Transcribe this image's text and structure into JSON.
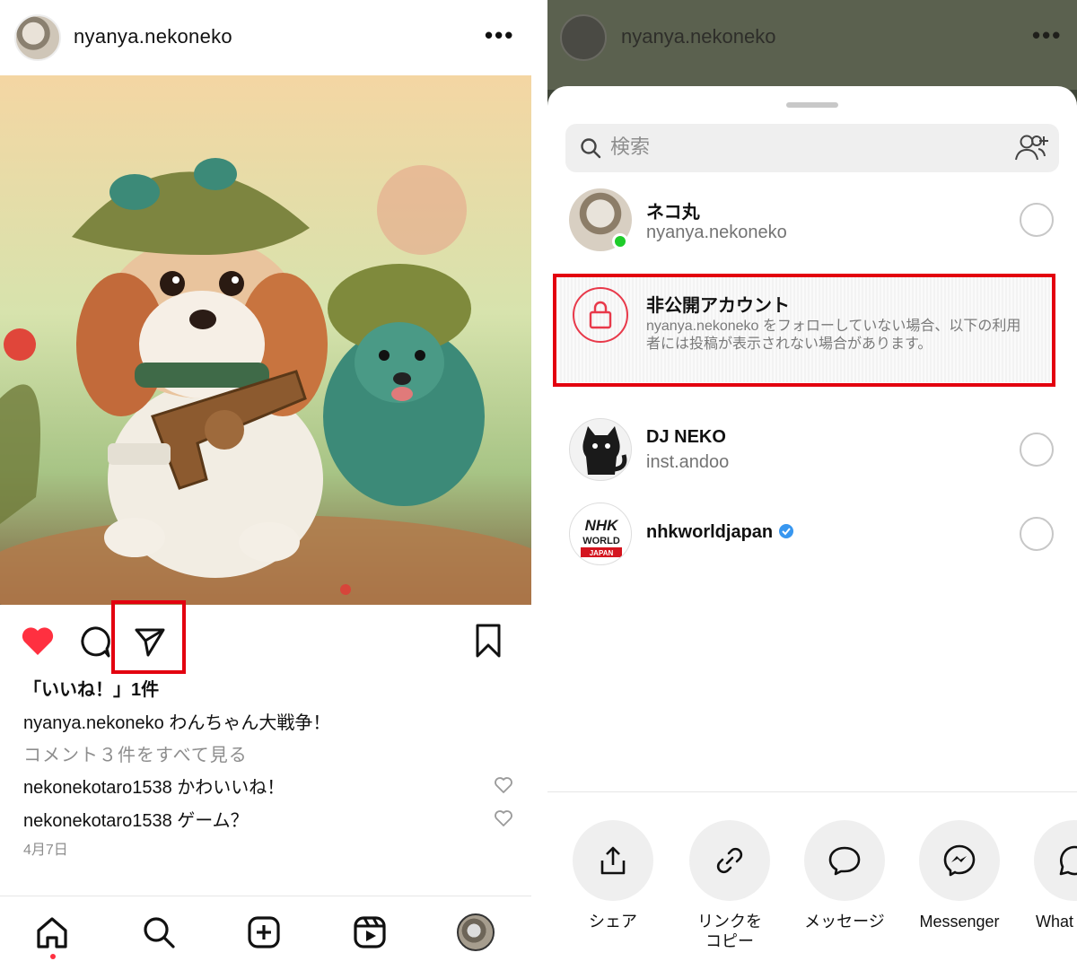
{
  "left": {
    "username": "nyanya.nekoneko",
    "more_icon": "•••",
    "likes_text": "「いいね！」1件",
    "caption": {
      "user": "nyanya.nekoneko",
      "text": " わんちゃん大戦争！"
    },
    "view_comments": "コメント３件をすべて見る",
    "comments": [
      {
        "user": "nekonekotaro1538",
        "text": " かわいいね！"
      },
      {
        "user": "nekonekotaro1538",
        "text": " ゲーム？"
      }
    ],
    "date": "4月7日",
    "nav": [
      "home-icon",
      "search-icon",
      "create-icon",
      "reels-icon",
      "profile-avatar"
    ]
  },
  "right": {
    "username": "nyanya.nekoneko",
    "more_icon": "•••",
    "search_placeholder": "検索",
    "contacts": [
      {
        "name": "ネコ丸",
        "sub": "nyanya.nekoneko"
      },
      {
        "name": "DJ NEKO",
        "sub": "inst.andoo"
      },
      {
        "name": "nhkworldjapan",
        "sub": ""
      }
    ],
    "private": {
      "title": "非公開アカウント",
      "desc": "nyanya.nekoneko をフォローしていない場合、以下の利用者には投稿が表示されない場合があります。"
    },
    "nhk_logo": {
      "line1": "NHK",
      "line2": "WORLD",
      "line3": "JAPAN"
    },
    "share_options": [
      {
        "label": "シェア"
      },
      {
        "label": "リンクを\nコピー"
      },
      {
        "label": "メッセージ"
      },
      {
        "label": "Messenger"
      },
      {
        "label": "What"
      }
    ]
  },
  "colors": {
    "accent_red": "#ff3040",
    "highlight_box": "#e3000f",
    "verified": "#3897f0",
    "online": "#1fcc2a"
  }
}
